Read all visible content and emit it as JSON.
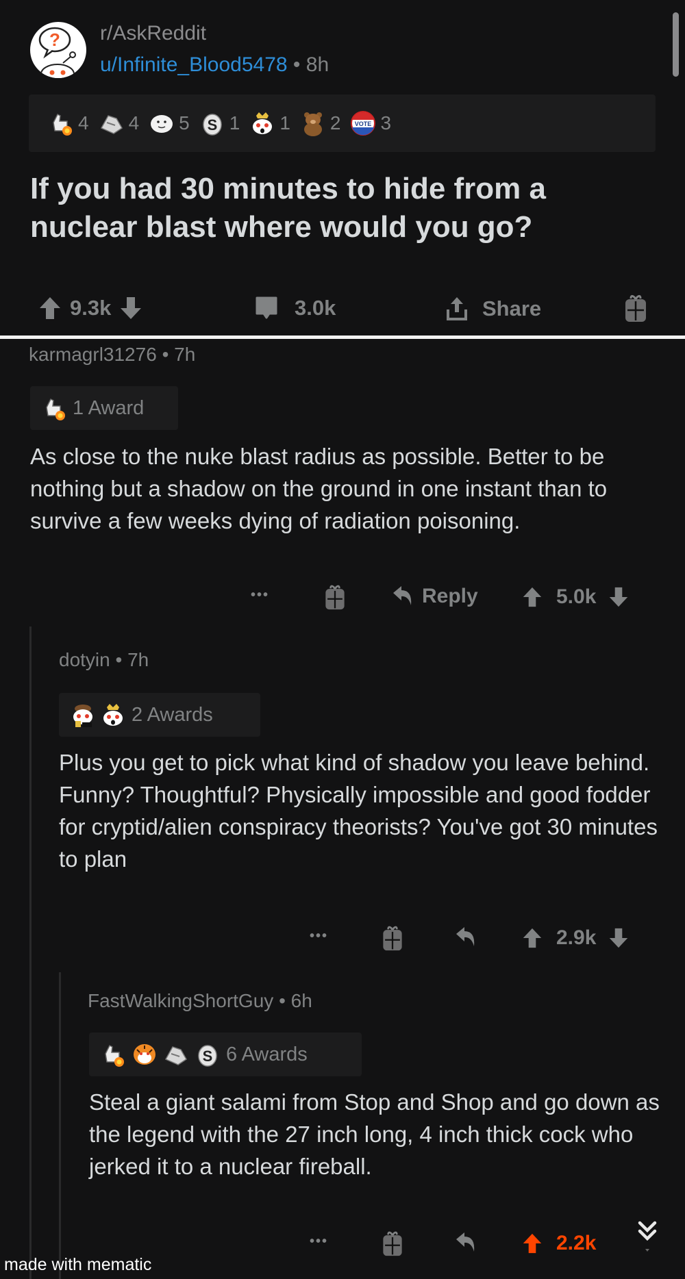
{
  "post": {
    "subreddit": "r/AskReddit",
    "author": "u/Infinite_Blood5478",
    "separator": "•",
    "age": "8h",
    "awards": [
      {
        "icon": "thumbs-up-fire-award-icon",
        "count": "4"
      },
      {
        "icon": "handshake-award-icon",
        "count": "4"
      },
      {
        "icon": "seal-award-icon",
        "count": "5"
      },
      {
        "icon": "silver-coin-award-icon",
        "count": "1"
      },
      {
        "icon": "snoo-crown-award-icon",
        "count": "1"
      },
      {
        "icon": "bear-award-icon",
        "count": "2"
      },
      {
        "icon": "vote-pin-award-icon",
        "count": "3"
      }
    ],
    "title": "If you had 30 minutes to hide from a nuclear blast where would you go?",
    "score": "9.3k",
    "comments": "3.0k",
    "share_label": "Share"
  },
  "comments": [
    {
      "author": "karmagrl31276",
      "separator": "•",
      "age": "7h",
      "awards_label": "1 Award",
      "award_icons": [
        "thumbs-up-fire-award-icon"
      ],
      "body": "As close to the nuke blast radius as possible. Better to be nothing but a shadow on the ground in one instant than to survive a few weeks dying of radiation poisoning.",
      "more": "•••",
      "reply_label": "Reply",
      "score": "5.0k"
    },
    {
      "author": "dotyin",
      "separator": "•",
      "age": "7h",
      "awards_label": "2 Awards",
      "award_icons": [
        "snoo-drink-award-icon",
        "snoo-crown-award-icon"
      ],
      "body": "Plus you get to pick what kind of shadow you leave behind. Funny? Thoughtful? Physically impossible and good fodder for cryptid/alien conspiracy theorists? You've got 30 minutes to plan",
      "more": "•••",
      "score": "2.9k"
    },
    {
      "author": "FastWalkingShortGuy",
      "separator": "•",
      "age": "6h",
      "awards_label": "6 Awards",
      "award_icons": [
        "thumbs-up-fire-award-icon",
        "tiger-award-icon",
        "handshake-award-icon",
        "silver-coin-award-icon"
      ],
      "body": "Steal a giant salami from Stop and Shop and go down as the legend with the 27 inch long, 4 inch thick cock who jerked it to a nuclear fireball.",
      "more": "•••",
      "score": "2.2k",
      "upvoted": true
    }
  ],
  "colors": {
    "background": "#121213",
    "upvote_active": "#ff4500",
    "link_blue": "#2e8ed8",
    "muted": "#818384"
  },
  "watermark": "made with mematic"
}
